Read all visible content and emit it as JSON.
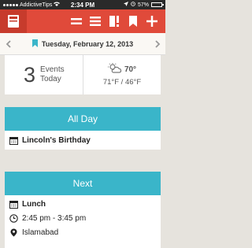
{
  "status_bar": {
    "carrier": "AddictiveTips",
    "time": "2:34 PM",
    "battery": "57%"
  },
  "toolbar": {
    "icons": [
      "app-logo-icon",
      "list-view-icon",
      "menu-icon",
      "priority-icon",
      "bookmark-icon",
      "add-icon"
    ]
  },
  "date_bar": {
    "date": "Tuesday, February 12, 2013"
  },
  "summary": {
    "count": "3",
    "label_line1": "Events",
    "label_line2": "Today",
    "temp": "70°",
    "range": "71°F / 46°F"
  },
  "all_day": {
    "header": "All Day",
    "event": "Lincoln's Birthday"
  },
  "next": {
    "header": "Next",
    "title": "Lunch",
    "time": "2:45 pm - 3:45 pm",
    "location": "Islamabad"
  },
  "colors": {
    "toolbar": "#e04a3a",
    "section_header": "#3ab5c9",
    "background": "#e6e3dd"
  }
}
